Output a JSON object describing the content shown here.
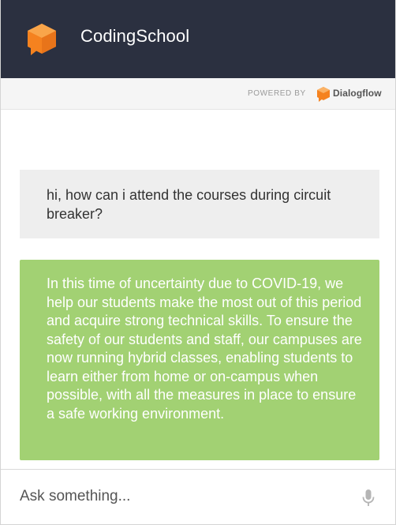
{
  "header": {
    "title": "CodingSchool",
    "logo_icon": "orange-box-chat-icon"
  },
  "powered": {
    "label": "POWERED BY",
    "brand": "Dialogflow",
    "brand_icon": "dialogflow-icon"
  },
  "messages": [
    {
      "role": "user",
      "text": "hi, how can i attend the courses during circuit breaker?"
    },
    {
      "role": "bot",
      "text": "In this time of uncertainty due to COVID-19, we help our students make the most out of this period and acquire strong technical skills. To ensure the safety of our students and staff, our campuses are now running hybrid classes, enabling students to learn either from home or on-campus when possible, with all the measures in place to ensure a safe working environment."
    }
  ],
  "input": {
    "placeholder": "Ask something...",
    "value": "",
    "mic_icon": "microphone-icon"
  },
  "colors": {
    "header_bg": "#2b3040",
    "accent_orange": "#f5821f",
    "user_bubble": "#eeeeee",
    "bot_bubble": "#a2d173"
  }
}
